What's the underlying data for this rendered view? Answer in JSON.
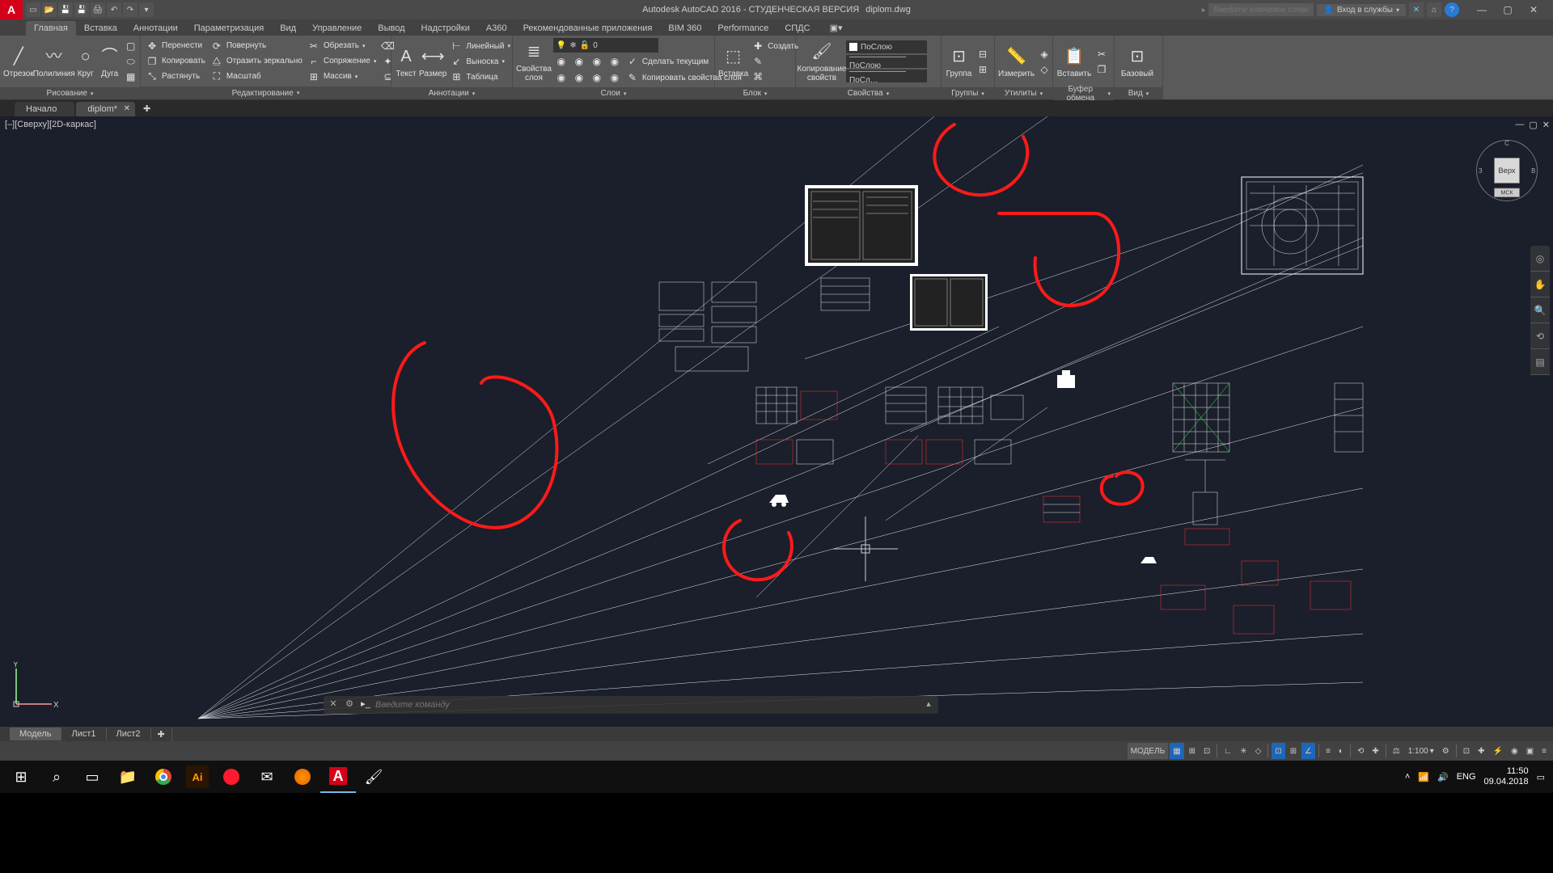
{
  "title": {
    "app": "Autodesk AutoCAD 2016 - СТУДЕНЧЕСКАЯ ВЕРСИЯ",
    "file": "diplom.dwg"
  },
  "search_placeholder": "Введите ключевое слово/фразу",
  "signin": "Вход в службы",
  "menu_tabs": [
    "Главная",
    "Вставка",
    "Аннотации",
    "Параметризация",
    "Вид",
    "Управление",
    "Вывод",
    "Надстройки",
    "A360",
    "Рекомендованные приложения",
    "BIM 360",
    "Performance",
    "СПДС"
  ],
  "ribbon": {
    "draw": {
      "title": "Рисование",
      "line": "Отрезок",
      "pline": "Полилиния",
      "circle": "Круг",
      "arc": "Дуга"
    },
    "modify": {
      "title": "Редактирование",
      "move": "Перенести",
      "copy": "Копировать",
      "stretch": "Растянуть",
      "rotate": "Повернуть",
      "mirror": "Отразить зеркально",
      "scale": "Масштаб",
      "trim": "Обрезать",
      "fillet": "Сопряжение",
      "array": "Массив"
    },
    "annot": {
      "title": "Аннотации",
      "text": "Текст",
      "dim": "Размер",
      "linear": "Линейный",
      "leader": "Выноска",
      "table": "Таблица"
    },
    "layers": {
      "title": "Слои",
      "props": "Свойства слоя",
      "current": "0",
      "make": "Сделать текущим",
      "match": "Копировать свойства слоя"
    },
    "block": {
      "title": "Блок",
      "insert": "Вставка",
      "create": "Создать"
    },
    "props": {
      "title": "Свойства",
      "clip": "Копирование свойств",
      "bylayer": "ПоСлою",
      "bylayer2": "———————ПоСлою",
      "bylayer3": "———————ПоСл…"
    },
    "groups": {
      "title": "Группы",
      "group": "Группа"
    },
    "utils": {
      "title": "Утилиты",
      "measure": "Измерить"
    },
    "clipboard": {
      "title": "Буфер обмена",
      "paste": "Вставить"
    },
    "view": {
      "title": "Вид",
      "base": "Базовый"
    }
  },
  "file_tabs": {
    "start": "Начало",
    "active": "diplom*"
  },
  "view_label": "[–][Сверху][2D-каркас]",
  "viewcube": {
    "top": "Верх",
    "wcs": "МСК",
    "c": "С",
    "e": "В",
    "w": "З"
  },
  "cmd_placeholder": "Введите команду",
  "model_tabs": {
    "model": "Модель",
    "l1": "Лист1",
    "l2": "Лист2"
  },
  "status": {
    "model": "МОДЕЛЬ",
    "scale": "1:100"
  },
  "taskbar": {
    "lang": "ENG",
    "time": "11:50",
    "date": "09.04.2018"
  }
}
